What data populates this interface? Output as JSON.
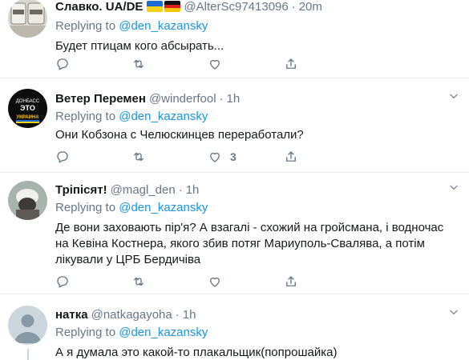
{
  "tweets": [
    {
      "name": "Славко. UA/DE",
      "handle": "@AlterSc97413096",
      "sep": "·",
      "time": "20m",
      "reply_prefix": "Replying to",
      "reply_to": "@den_kazansky",
      "text": "Будет птицам кого абсырать...",
      "retweets": "",
      "likes": ""
    },
    {
      "name": "Ветер Перемен",
      "handle": "@winderfool",
      "sep": "·",
      "time": "1h",
      "reply_prefix": "Replying to",
      "reply_to": "@den_kazansky",
      "text": "Они Кобзона с Челюскинцев переработали?",
      "retweets": "",
      "likes": "3",
      "avatar_text": [
        "ДОНБАСС",
        "ЭТО",
        "УКРАИНА"
      ]
    },
    {
      "name": "Тріпісят!",
      "handle": "@magl_den",
      "sep": "·",
      "time": "1h",
      "reply_prefix": "Replying to",
      "reply_to": "@den_kazansky",
      "text_lines": [
        "Де вони заховають пір'я? А взагалі - схожий на гройсмана, і водночас",
        "на Кевіна Костнера, якого збив потяг Мариуполь-Свалява, а потім",
        "лікували у ЦРБ Бердичіва"
      ],
      "retweets": "",
      "likes": ""
    },
    {
      "name": "натка",
      "handle": "@natkagayoha",
      "sep": "·",
      "time": "1h",
      "reply_prefix": "Replying to",
      "reply_to": "@den_kazansky",
      "text": "А я думала это какой-то плакальщик(попрошайка)"
    }
  ],
  "icons": {
    "reply": "reply-icon",
    "retweet": "retweet-icon",
    "like": "heart-icon",
    "share": "share-icon",
    "caret": "chevron-down-icon"
  },
  "colors": {
    "text": "#14171a",
    "secondary": "#657786",
    "link": "#1b95e0",
    "divider": "#e6ecf0"
  }
}
